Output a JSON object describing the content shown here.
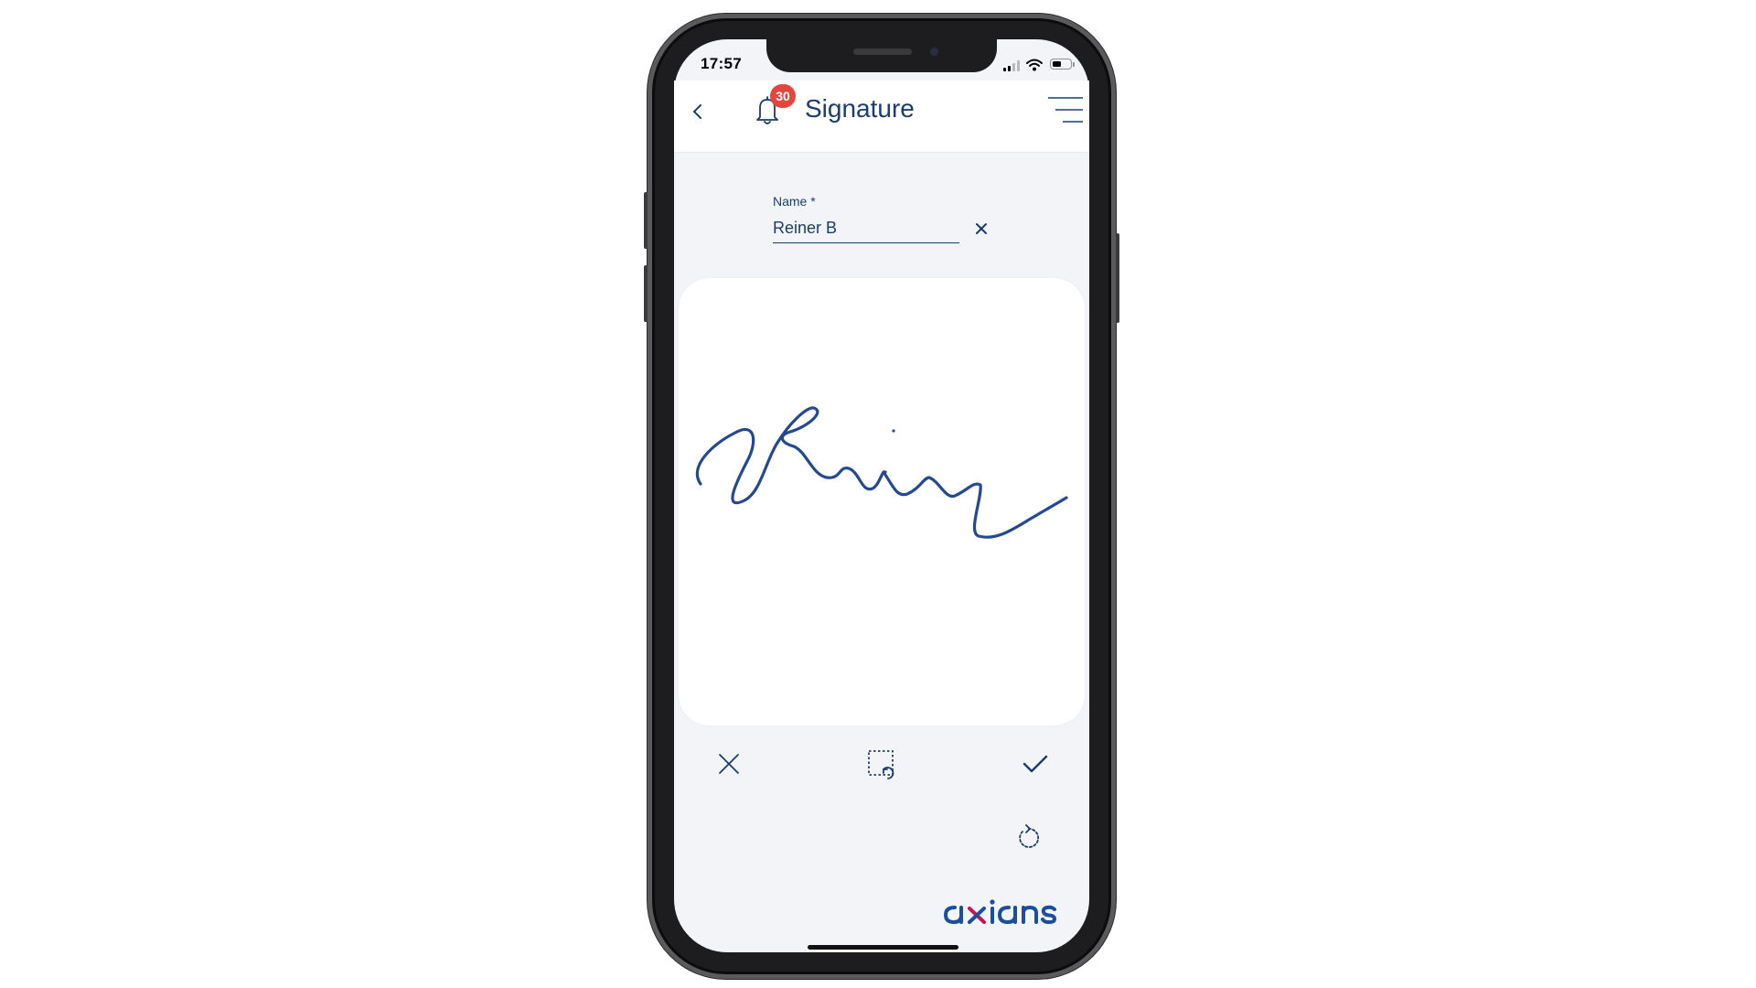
{
  "status_bar": {
    "time": "17:57",
    "icons": [
      "cellular-signal-icon",
      "wifi-icon",
      "battery-icon"
    ]
  },
  "header": {
    "title": "Signature",
    "notification_count": "30",
    "icons": [
      "back-chevron-icon",
      "bell-icon",
      "menu-lines-icon"
    ]
  },
  "form": {
    "name_label": "Name *",
    "name_value": "Reiner B"
  },
  "actions": {
    "icons": [
      "close-icon",
      "crop-reset-icon",
      "checkmark-icon",
      "rotate-icon"
    ]
  },
  "brand": {
    "logo_text": "axians",
    "colors": {
      "logo_blue": "#1b4f9c",
      "logo_magenta": "#c2185b"
    }
  },
  "colors": {
    "accent": "#1b3d6d",
    "signature_ink": "#24498f",
    "badge": "#e2463c",
    "background": "#f3f4f7"
  }
}
